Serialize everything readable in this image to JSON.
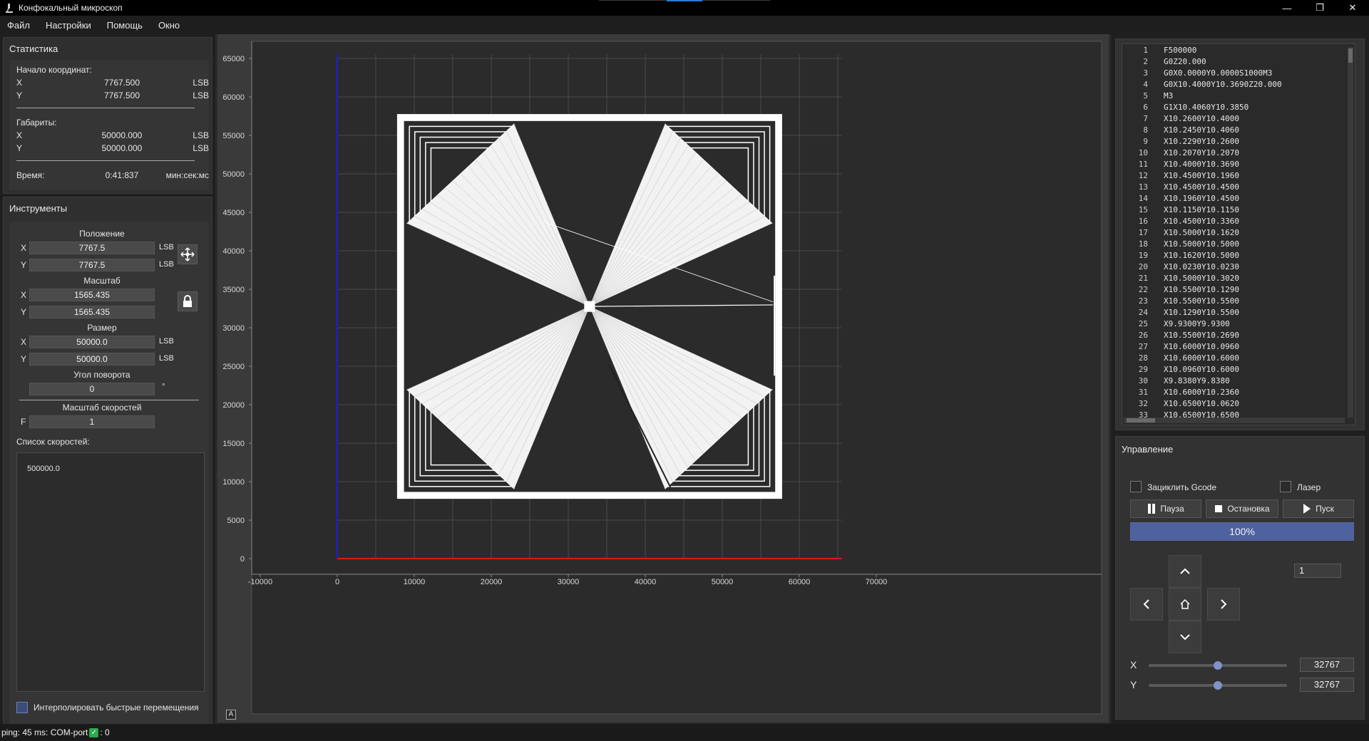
{
  "window": {
    "title": "Конфокальный микроскоп",
    "controls": [
      "—",
      "❐",
      "✕"
    ]
  },
  "menu": [
    "Файл",
    "Настройки",
    "Помощь",
    "Окно"
  ],
  "stats": {
    "title": "Статистика",
    "origin_label": "Начало координат:",
    "origin": [
      {
        "axis": "X",
        "value": "7767.500",
        "unit": "LSB"
      },
      {
        "axis": "Y",
        "value": "7767.500",
        "unit": "LSB"
      }
    ],
    "dims_label": "Габариты:",
    "dims": [
      {
        "axis": "X",
        "value": "50000.000",
        "unit": "LSB"
      },
      {
        "axis": "Y",
        "value": "50000.000",
        "unit": "LSB"
      }
    ],
    "time_label": "Время:",
    "time_value": "0:41:837",
    "time_unit": "мин:сек:мс"
  },
  "tools": {
    "title": "Инструменты",
    "position_label": "Положение",
    "position": {
      "x": "7767.5",
      "y": "7767.5",
      "unit": "LSB"
    },
    "scale_label": "Масштаб",
    "scale": {
      "x": "1565.435",
      "y": "1565.435"
    },
    "size_label": "Размер",
    "size": {
      "x": "50000.0",
      "y": "50000.0",
      "unit": "LSB"
    },
    "rotation_label": "Угол поворота",
    "rotation": {
      "value": "0",
      "unit": "°"
    },
    "speed_scale_label": "Масштаб скоростей",
    "speed_scale": {
      "axis": "F",
      "value": "1"
    },
    "speed_list_label": "Список скоростей:",
    "speed_list": [
      "500000.0"
    ],
    "interpolate_label": "Интерполировать быстрые перемещения",
    "interpolate_checked": true,
    "axis_x": "X",
    "axis_y": "Y"
  },
  "plot": {
    "x_ticks": [
      "-10000",
      "0",
      "10000",
      "20000",
      "30000",
      "40000",
      "50000",
      "60000",
      "70000"
    ],
    "y_ticks": [
      "0",
      "5000",
      "10000",
      "15000",
      "20000",
      "25000",
      "30000",
      "35000",
      "40000",
      "45000",
      "50000",
      "55000",
      "60000",
      "65000"
    ],
    "x_axis_color": "#d61a1a",
    "y_axis_color": "#1d1dd6",
    "corner_button": "A"
  },
  "gcode": [
    "F500000",
    "G0Z20.000",
    "G0X0.0000Y0.0000S1000M3",
    "G0X10.4000Y10.3690Z20.000",
    "M3",
    "G1X10.4060Y10.3850",
    "X10.2600Y10.4000",
    "X10.2450Y10.4060",
    "X10.2290Y10.2600",
    "X10.2070Y10.2070",
    "X10.4000Y10.3690",
    "X10.4500Y10.1960",
    "X10.4500Y10.4500",
    "X10.1960Y10.4500",
    "X10.1150Y10.1150",
    "X10.4500Y10.3360",
    "X10.5000Y10.1620",
    "X10.5000Y10.5000",
    "X10.1620Y10.5000",
    "X10.0230Y10.0230",
    "X10.5000Y10.3020",
    "X10.5500Y10.1290",
    "X10.5500Y10.5500",
    "X10.1290Y10.5500",
    "X9.9300Y9.9300",
    "X10.5500Y10.2690",
    "X10.6000Y10.0960",
    "X10.6000Y10.6000",
    "X10.0960Y10.6000",
    "X9.8380Y9.8380",
    "X10.6000Y10.2360",
    "X10.6500Y10.0620",
    "X10.6500Y10.6500"
  ],
  "control": {
    "title": "Управление",
    "loop_label": "Зациклить Gcode",
    "laser_label": "Лазер",
    "pause_label": "Пауза",
    "stop_label": "Остановка",
    "start_label": "Пуск",
    "progress": 100,
    "progress_text": "100%",
    "step_value": "1",
    "x_label": "X",
    "y_label": "Y",
    "x_value": "32767",
    "y_value": "32767",
    "x_slider_fraction": 0.5,
    "y_slider_fraction": 0.5
  },
  "status": {
    "text": "ping: 45 ms: COM-port",
    "after": ": 0"
  }
}
